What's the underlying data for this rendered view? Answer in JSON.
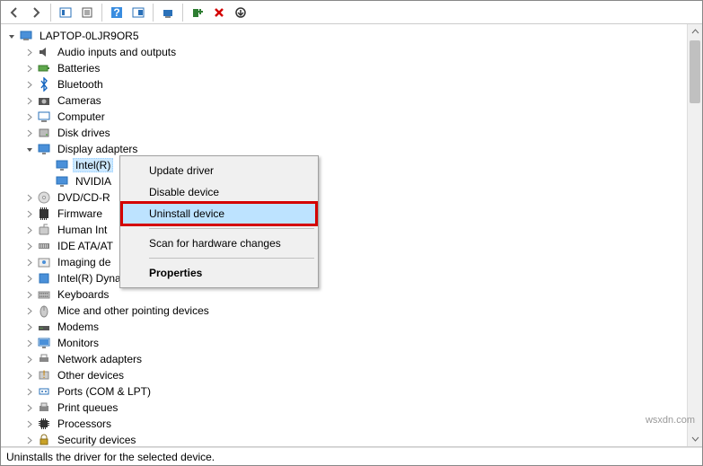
{
  "toolbar": {
    "back": "←",
    "forward": "→",
    "view": "view",
    "refresh": "refresh",
    "help": "?",
    "props": "props",
    "scan": "scan",
    "add_legacy": "add",
    "remove": "✕",
    "more": "more"
  },
  "root": {
    "label": "LAPTOP-0LJR9OR5"
  },
  "categories": [
    {
      "label": "Audio inputs and outputs",
      "expanded": false,
      "icon": "audio"
    },
    {
      "label": "Batteries",
      "expanded": false,
      "icon": "battery"
    },
    {
      "label": "Bluetooth",
      "expanded": false,
      "icon": "bluetooth"
    },
    {
      "label": "Cameras",
      "expanded": false,
      "icon": "camera"
    },
    {
      "label": "Computer",
      "expanded": false,
      "icon": "computer"
    },
    {
      "label": "Disk drives",
      "expanded": false,
      "icon": "disk"
    },
    {
      "label": "Display adapters",
      "expanded": true,
      "icon": "display",
      "children": [
        {
          "label": "Intel(R)",
          "selected": true,
          "icon": "display"
        },
        {
          "label": "NVIDIA",
          "selected": false,
          "icon": "display"
        }
      ]
    },
    {
      "label": "DVD/CD-R",
      "expanded": false,
      "icon": "dvd"
    },
    {
      "label": "Firmware",
      "expanded": false,
      "icon": "firmware"
    },
    {
      "label": "Human Int",
      "expanded": false,
      "icon": "hid"
    },
    {
      "label": "IDE ATA/AT",
      "expanded": false,
      "icon": "ide"
    },
    {
      "label": "Imaging de",
      "expanded": false,
      "icon": "imaging"
    },
    {
      "label": "Intel(R) Dynamic Platform and Thermal Framework",
      "expanded": false,
      "icon": "thermal"
    },
    {
      "label": "Keyboards",
      "expanded": false,
      "icon": "keyboard"
    },
    {
      "label": "Mice and other pointing devices",
      "expanded": false,
      "icon": "mouse"
    },
    {
      "label": "Modems",
      "expanded": false,
      "icon": "modem"
    },
    {
      "label": "Monitors",
      "expanded": false,
      "icon": "monitor"
    },
    {
      "label": "Network adapters",
      "expanded": false,
      "icon": "network"
    },
    {
      "label": "Other devices",
      "expanded": false,
      "icon": "other"
    },
    {
      "label": "Ports (COM & LPT)",
      "expanded": false,
      "icon": "ports"
    },
    {
      "label": "Print queues",
      "expanded": false,
      "icon": "print"
    },
    {
      "label": "Processors",
      "expanded": false,
      "icon": "processor"
    },
    {
      "label": "Security devices",
      "expanded": false,
      "icon": "security"
    }
  ],
  "context_menu": {
    "items": [
      {
        "label": "Update driver",
        "hover": false
      },
      {
        "label": "Disable device",
        "hover": false
      },
      {
        "label": "Uninstall device",
        "hover": true,
        "highlighted": true
      },
      {
        "separator": true
      },
      {
        "label": "Scan for hardware changes",
        "hover": false
      },
      {
        "separator": true
      },
      {
        "label": "Properties",
        "bold": true
      }
    ]
  },
  "status": "Uninstalls the driver for the selected device.",
  "watermark": "wsxdn.com"
}
